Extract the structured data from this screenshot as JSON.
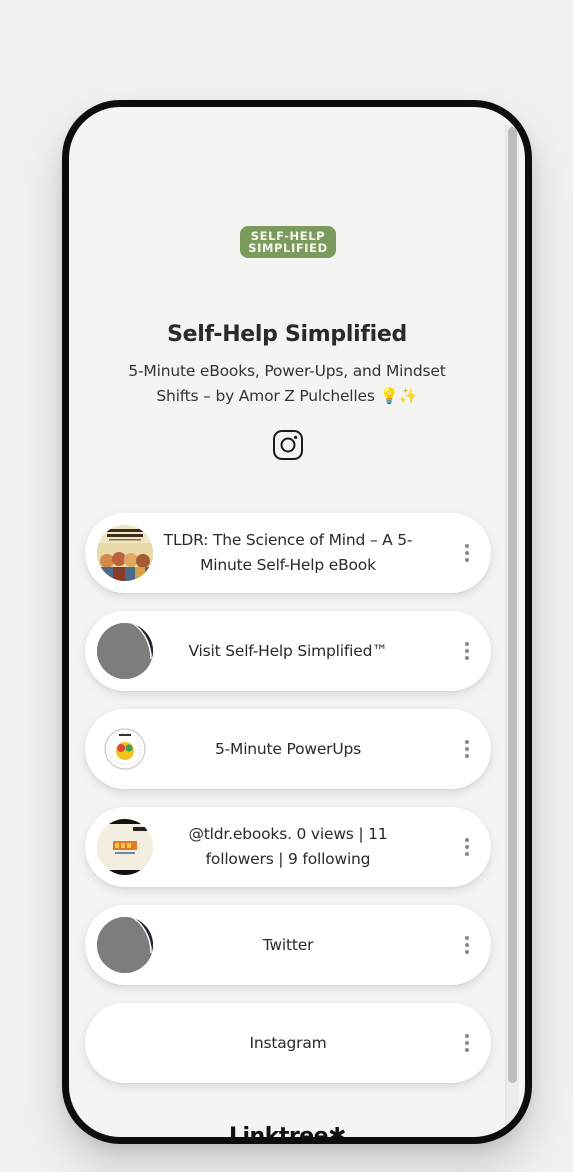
{
  "profile": {
    "logo_line1": "SELF-HELP",
    "logo_line2": "SIMPLIFIED",
    "name": "Self-Help Simplified",
    "bio": "5-Minute eBooks, Power-Ups, and Mindset Shifts – by Amor Z Pulchelles 💡✨",
    "social_icon": "instagram-icon"
  },
  "links": [
    {
      "label": "TLDR: The Science of Mind – A 5-Minute Self-Help eBook",
      "thumb": "ebook-cover",
      "menu_icon": "more-vertical-icon"
    },
    {
      "label": "Visit Self-Help Simplified™",
      "thumb": "gray-placeholder",
      "menu_icon": "more-vertical-icon"
    },
    {
      "label": "5-Minute PowerUps",
      "thumb": "powerups-badge",
      "menu_icon": "more-vertical-icon"
    },
    {
      "label": "@tldr.ebooks. 0 views | 11 followers | 9 following",
      "thumb": "tldr-logo",
      "menu_icon": "more-vertical-icon"
    },
    {
      "label": "Twitter",
      "thumb": "gray-placeholder",
      "menu_icon": "more-vertical-icon"
    },
    {
      "label": "Instagram",
      "thumb": "",
      "menu_icon": "more-vertical-icon"
    }
  ],
  "footer": {
    "brand": "Linktree✱"
  },
  "colors": {
    "page_background": "#f1f1ef",
    "phone_frame": "#0d0d0d",
    "screen_background": "#f4f4f2",
    "logo_badge": "#7c9a5c",
    "card_background": "#ffffff",
    "text": "#2a2a2a"
  }
}
